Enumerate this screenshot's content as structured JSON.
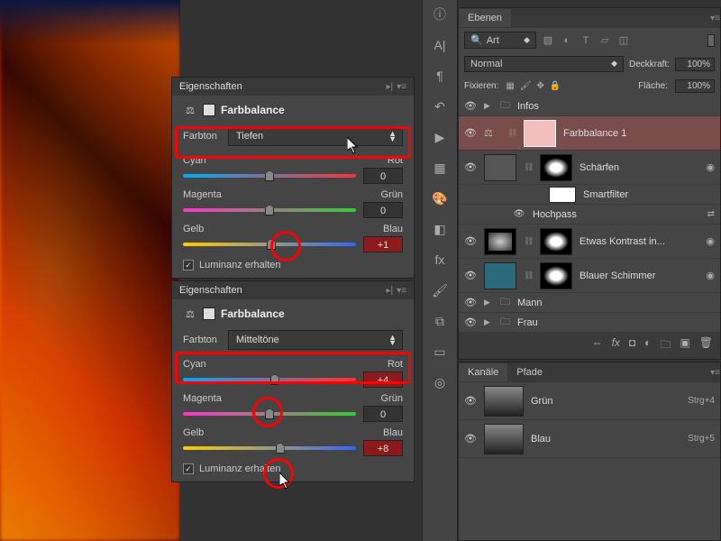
{
  "properties_panels": [
    {
      "title": "Eigenschaften",
      "adjustment_label": "Farbbalance",
      "tone_label": "Farbton",
      "tone_value": "Tiefen",
      "sliders": [
        {
          "left": "Cyan",
          "right": "Rot",
          "value": "0",
          "pos": 50,
          "red": false
        },
        {
          "left": "Magenta",
          "right": "Grün",
          "value": "0",
          "pos": 50,
          "red": false
        },
        {
          "left": "Gelb",
          "right": "Blau",
          "value": "+1",
          "pos": 51,
          "red": true
        }
      ],
      "preserve_lum": "Luminanz erhalten"
    },
    {
      "title": "Eigenschaften",
      "adjustment_label": "Farbbalance",
      "tone_label": "Farbton",
      "tone_value": "Mitteltöne",
      "sliders": [
        {
          "left": "Cyan",
          "right": "Rot",
          "value": "+4",
          "pos": 53,
          "red": true
        },
        {
          "left": "Magenta",
          "right": "Grün",
          "value": "0",
          "pos": 50,
          "red": false
        },
        {
          "left": "Gelb",
          "right": "Blau",
          "value": "+8",
          "pos": 56,
          "red": true
        }
      ],
      "preserve_lum": "Luminanz erhalten"
    }
  ],
  "layers": {
    "tab": "Ebenen",
    "filter_label": "Art",
    "blend_mode": "Normal",
    "opacity_label": "Deckkraft:",
    "opacity_value": "100%",
    "lock_label": "Fixieren:",
    "fill_label": "Fläche:",
    "fill_value": "100%",
    "items": [
      {
        "type": "group",
        "name": "Infos"
      },
      {
        "type": "adjustment",
        "name": "Farbbalance 1",
        "selected": true
      },
      {
        "type": "smart",
        "name": "Schärfen"
      },
      {
        "type": "filterlabel",
        "name": "Smartfilter"
      },
      {
        "type": "subfilter",
        "name": "Hochpass"
      },
      {
        "type": "smart",
        "name": "Etwas Kontrast in..."
      },
      {
        "type": "smart",
        "name": "Blauer Schimmer"
      },
      {
        "type": "group",
        "name": "Mann"
      },
      {
        "type": "group",
        "name": "Frau"
      }
    ]
  },
  "channels": {
    "tab1": "Kanäle",
    "tab2": "Pfade",
    "items": [
      {
        "name": "Grün",
        "shortcut": "Strg+4"
      },
      {
        "name": "Blau",
        "shortcut": "Strg+5"
      }
    ]
  }
}
